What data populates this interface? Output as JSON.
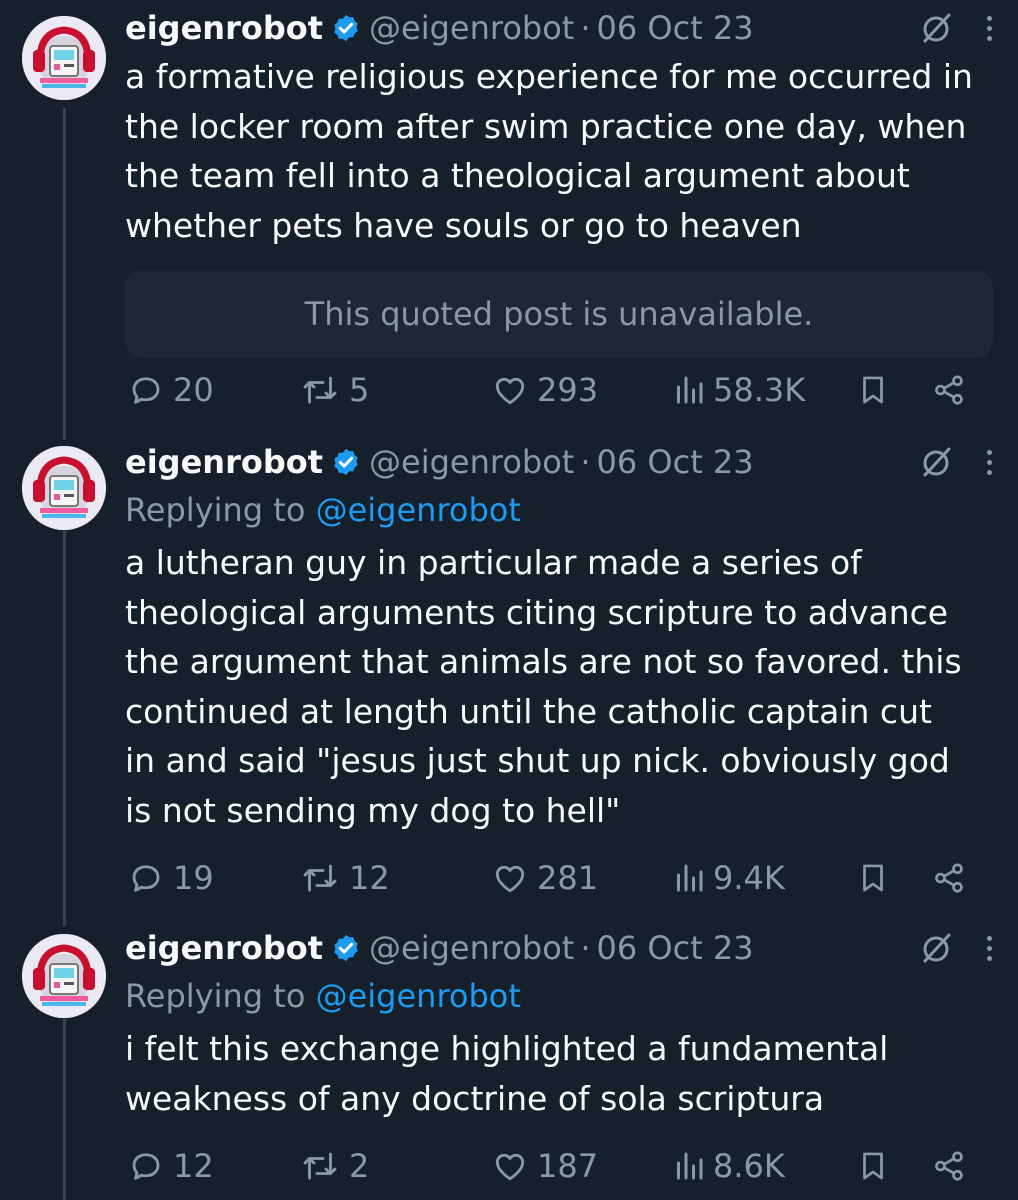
{
  "colors": {
    "background": "#15202b",
    "text_primary": "#f7f9f9",
    "text_secondary": "#8b98a5",
    "link": "#1d9bf0",
    "verified": "#1d9bf0",
    "quote_background": "#1e2732",
    "thread_line": "#38444d"
  },
  "icons": {
    "verified": "verified-badge-icon",
    "grok": "grok-icon",
    "more": "more-vertical-icon",
    "reply": "reply-icon",
    "repost": "repost-icon",
    "like": "heart-icon",
    "views": "views-icon",
    "bookmark": "bookmark-icon",
    "share": "share-icon"
  },
  "posts": [
    {
      "author": {
        "name": "eigenrobot",
        "handle": "@eigenrobot",
        "separator": "·",
        "date": "06 Oct 23"
      },
      "text_lines": [
        "a formative religious experience for me occurred in",
        "the locker room after swim practice one day, when",
        "the team fell into a theological argument about",
        "whether pets have souls or go to heaven"
      ],
      "quote_unavailable": "This quoted post is unavailable.",
      "stats": {
        "replies": "20",
        "reposts": "5",
        "likes": "293",
        "views": "58.3K"
      }
    },
    {
      "author": {
        "name": "eigenrobot",
        "handle": "@eigenrobot",
        "separator": "·",
        "date": "06 Oct 23"
      },
      "replying_to": {
        "prefix": "Replying to",
        "handle": "@eigenrobot"
      },
      "text_lines": [
        "a lutheran guy in particular made a series of",
        "theological arguments citing scripture to advance",
        "the argument that animals are not so favored. this",
        "continued at length until the catholic captain cut",
        "in and said \"jesus just shut up nick. obviously god",
        "is not sending my dog to hell\""
      ],
      "stats": {
        "replies": "19",
        "reposts": "12",
        "likes": "281",
        "views": "9.4K"
      }
    },
    {
      "author": {
        "name": "eigenrobot",
        "handle": "@eigenrobot",
        "separator": "·",
        "date": "06 Oct 23"
      },
      "replying_to": {
        "prefix": "Replying to",
        "handle": "@eigenrobot"
      },
      "text_lines": [
        "i felt this exchange highlighted a fundamental",
        "weakness of any doctrine of sola scriptura"
      ],
      "stats": {
        "replies": "12",
        "reposts": "2",
        "likes": "187",
        "views": "8.6K"
      }
    }
  ]
}
